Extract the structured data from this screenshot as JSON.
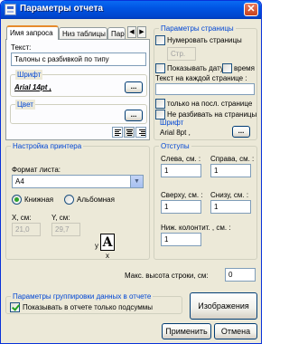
{
  "window": {
    "title": "Параметры отчета",
    "close_glyph": "✕"
  },
  "tabs": [
    "Имя запроса",
    "Низ таблицы",
    "Пар"
  ],
  "tab_arrows": [
    "◀",
    "▶"
  ],
  "query_tab": {
    "text_label": "Текст:",
    "text_value": "Талоны с разбивкой по типу",
    "font_group": "Шрифт",
    "font_value": "Arial 14pt ,",
    "font_button": "...",
    "color_group": "Цвет",
    "color_button": "..."
  },
  "page_params": {
    "title": "Параметры страницы",
    "number_pages_label": "Нумеровать страницы",
    "page_placeholder": "Стр.",
    "show_date_label": "Показывать дату",
    "time_label": "время",
    "text_each_page_label": "Текст на каждой странице :",
    "last_page_only_label": "только на посл. странице",
    "no_split_label": "Не разбивать на страницы",
    "font_label": "Шрифт",
    "font_value": "Arial 8pt ,",
    "font_button": "..."
  },
  "printer": {
    "title": "Настройка принтера",
    "sheet_format_label": "Формат листа:",
    "sheet_format_value": "A4",
    "portrait_label": "Книжная",
    "landscape_label": "Альбомная",
    "x_label": "X, см:",
    "y_label": "Y, см:",
    "x_value": "21,0",
    "y_value": "29,7",
    "axis_y": "y",
    "axis_x": "x",
    "page_glyph": "A"
  },
  "margins": {
    "title": "Отступы",
    "left_label": "Слева, см. :",
    "right_label": "Справа, см. :",
    "top_label": "Сверху, см. :",
    "bottom_label": "Снизу, см. :",
    "footer_label": "Ниж. колонтит. , см. :",
    "left_value": "1",
    "right_value": "1",
    "top_value": "1",
    "bottom_value": "1",
    "footer_value": "1"
  },
  "max_row_height": {
    "label": "Макс. высота строки, см:",
    "value": "0"
  },
  "grouping": {
    "title": "Параметры группировки данных в отчете",
    "subtotals_label": "Показывать в отчете только подсуммы"
  },
  "buttons": {
    "images": "Изображения",
    "apply": "Применить",
    "cancel": "Отмена"
  },
  "colors": {
    "title_bar": "#0054e3",
    "group_title": "#0046d5",
    "dialog_bg": "#ece9d8"
  }
}
